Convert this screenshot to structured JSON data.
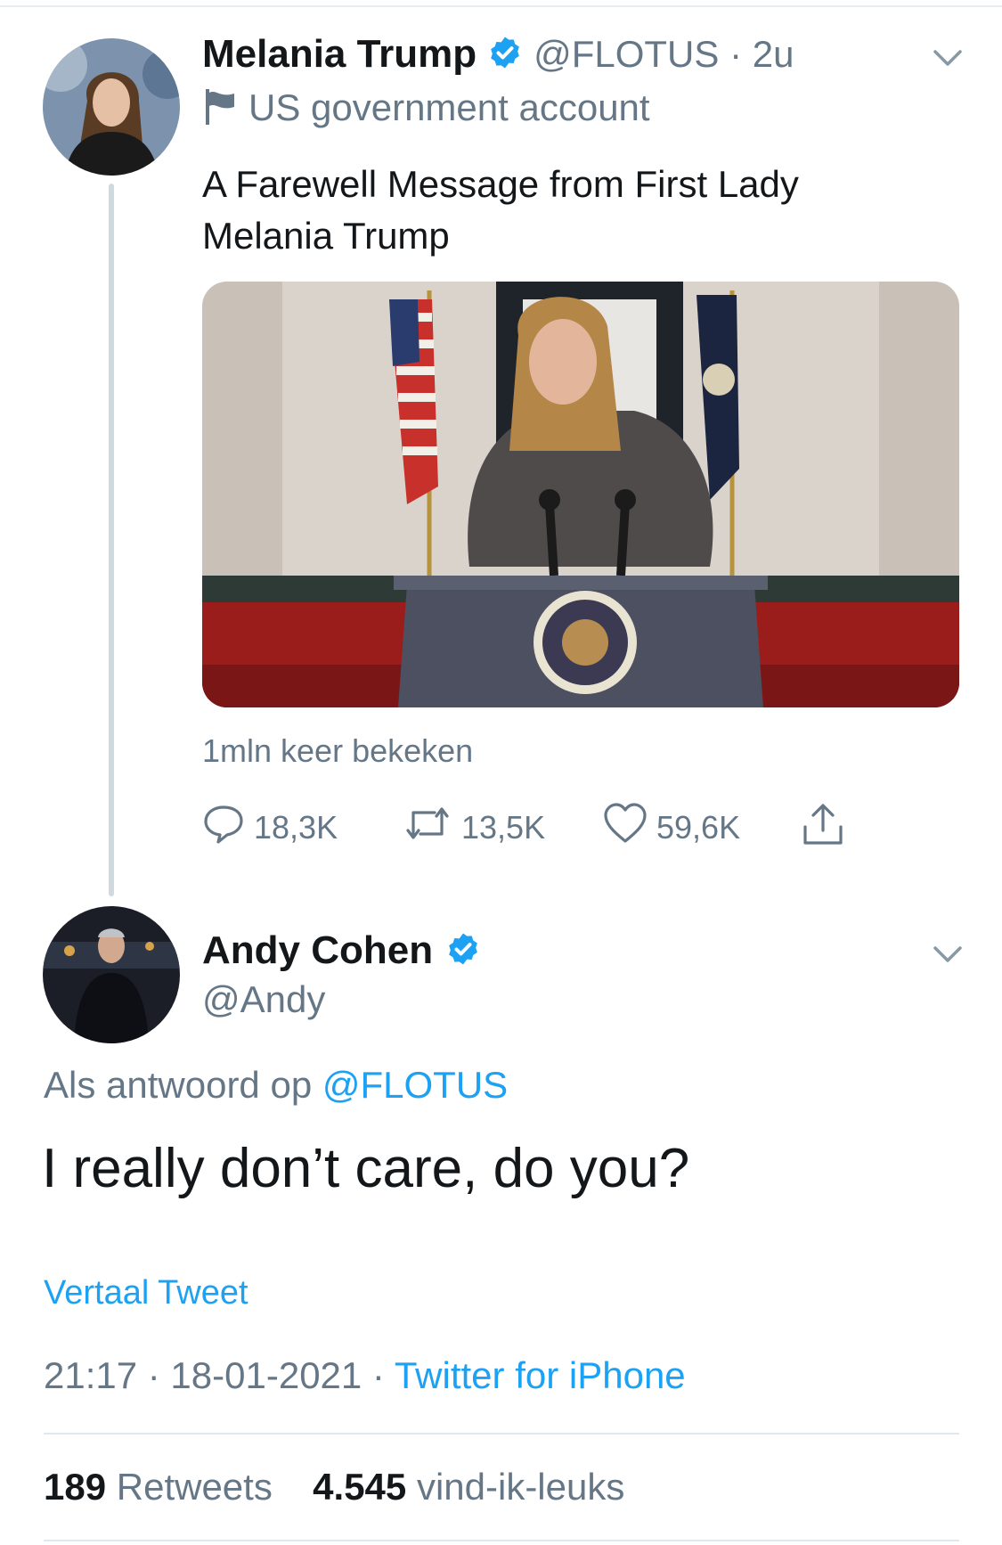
{
  "original_tweet": {
    "author_name": "Melania Trump",
    "handle_time": "@FLOTUS · 2u",
    "label": "US government account",
    "text_line1": "A Farewell Message from First Lady",
    "text_line2": "Melania Trump",
    "views": "1mln keer bekeken",
    "actions": {
      "replies": "18,3K",
      "retweets": "13,5K",
      "likes": "59,6K"
    }
  },
  "reply_tweet": {
    "author_name": "Andy Cohen",
    "handle": "@Andy",
    "replying_prefix": "Als antwoord op",
    "replying_to": "@FLOTUS",
    "text": "I really don’t care, do you?",
    "translate": "Vertaal Tweet",
    "timestamp": "21:17 · 18-01-2021 · ",
    "source": "Twitter for iPhone",
    "stats": {
      "retweet_count": "189",
      "retweet_label": "Retweets",
      "like_count": "4.545",
      "like_label": "vind-ik-leuks"
    }
  },
  "colors": {
    "link_blue": "#1da1f2",
    "secondary_text": "#657786",
    "verified_badge": "#1da1f2"
  },
  "icons": [
    "verified-badge-icon",
    "government-flag-icon",
    "chevron-down-icon",
    "reply-icon",
    "retweet-icon",
    "like-icon",
    "share-icon"
  ]
}
